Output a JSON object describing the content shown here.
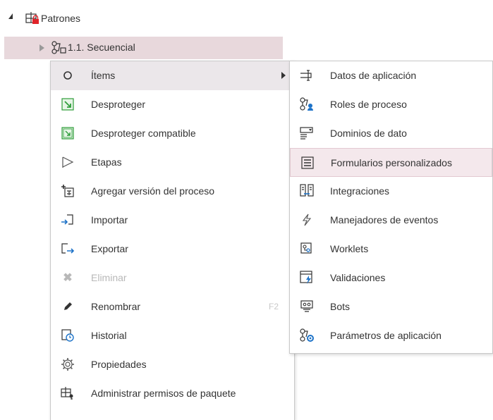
{
  "tree": {
    "root": {
      "label": "Patrones",
      "icon": "package-locked-icon"
    },
    "child": {
      "label": "1.1. Secuencial",
      "icon": "process-icon"
    }
  },
  "context_menu": {
    "items": [
      {
        "label": "Ítems",
        "icon": "circle-icon",
        "has_submenu": true
      },
      {
        "label": "Desproteger",
        "icon": "uncheckin-icon"
      },
      {
        "label": "Desproteger compatible",
        "icon": "uncheckin-compatible-icon"
      },
      {
        "label": "Etapas",
        "icon": "flag-icon"
      },
      {
        "label": "Agregar versión del proceso",
        "icon": "add-version-icon"
      },
      {
        "label": "Importar",
        "icon": "import-icon"
      },
      {
        "label": "Exportar",
        "icon": "export-icon"
      },
      {
        "label": "Eliminar",
        "icon": "delete-icon",
        "disabled": true
      },
      {
        "label": "Renombrar",
        "icon": "pencil-icon",
        "shortcut": "F2"
      },
      {
        "label": "Historial",
        "icon": "history-icon"
      },
      {
        "label": "Propiedades",
        "icon": "gear-icon"
      },
      {
        "label": "Administrar permisos de paquete",
        "icon": "permissions-icon"
      }
    ]
  },
  "submenu": {
    "items": [
      {
        "label": "Datos de aplicación",
        "icon": "application-data-icon"
      },
      {
        "label": "Roles de proceso",
        "icon": "process-roles-icon"
      },
      {
        "label": "Dominios de dato",
        "icon": "data-domains-icon"
      },
      {
        "label": "Formularios personalizados",
        "icon": "custom-forms-icon",
        "highlighted": true
      },
      {
        "label": "Integraciones",
        "icon": "integrations-icon"
      },
      {
        "label": "Manejadores de eventos",
        "icon": "event-handlers-icon"
      },
      {
        "label": "Worklets",
        "icon": "worklets-icon"
      },
      {
        "label": "Validaciones",
        "icon": "validations-icon"
      },
      {
        "label": "Bots",
        "icon": "bots-icon"
      },
      {
        "label": "Parámetros de aplicación",
        "icon": "application-parameters-icon"
      }
    ]
  },
  "colors": {
    "selection": "#e8d8dc",
    "hover": "#ebe7ea",
    "accent_red": "#e0242a",
    "accent_green": "#2e9d3a",
    "accent_blue": "#1e73c8"
  }
}
